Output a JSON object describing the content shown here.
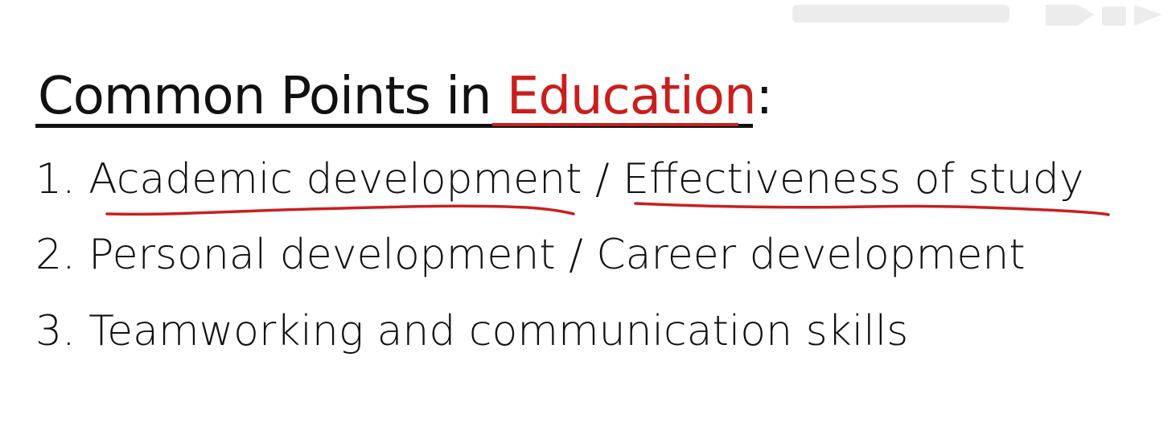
{
  "heading": {
    "prefix": "Common Points in ",
    "accent": "Education",
    "suffix": ":"
  },
  "list": {
    "items": [
      {
        "number": "1.",
        "part1": "Academic development",
        "separator": "/",
        "part2": "Effectiveness of study"
      },
      {
        "number": "2.",
        "text": "Personal development / Career development"
      },
      {
        "number": "3.",
        "text": "Teamworking and communication skills"
      }
    ]
  },
  "colors": {
    "accent": "#c8201e",
    "text": "#111111",
    "background": "#ffffff"
  }
}
